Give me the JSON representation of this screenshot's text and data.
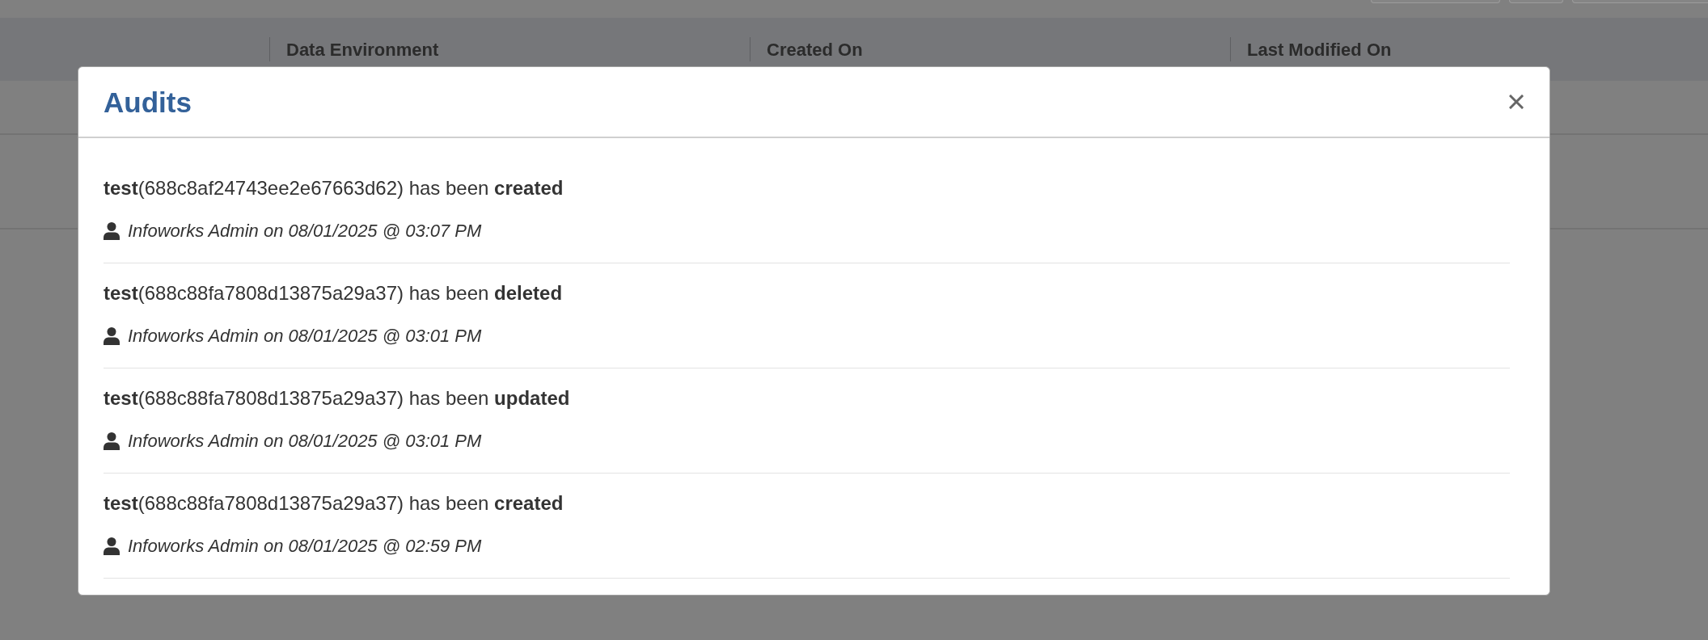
{
  "background_table": {
    "columns": [
      {
        "label": "Data Environment"
      },
      {
        "label": "Created On"
      },
      {
        "label": "Last Modified On"
      }
    ]
  },
  "dialog": {
    "title": "Audits",
    "entries": [
      {
        "message": "**test**(688c8af24743ee2e67663d62) has been **created**",
        "author_line": "Infoworks Admin on 08/01/2025 @ 03:07 PM"
      },
      {
        "message": "**test**(688c88fa7808d13875a29a37) has been **deleted**",
        "author_line": "Infoworks Admin on 08/01/2025 @ 03:01 PM"
      },
      {
        "message": "**test**(688c88fa7808d13875a29a37) has been **updated**",
        "author_line": "Infoworks Admin on 08/01/2025 @ 03:01 PM"
      },
      {
        "message": "**test**(688c88fa7808d13875a29a37) has been **created**",
        "author_line": "Infoworks Admin on 08/01/2025 @ 02:59 PM"
      }
    ]
  }
}
